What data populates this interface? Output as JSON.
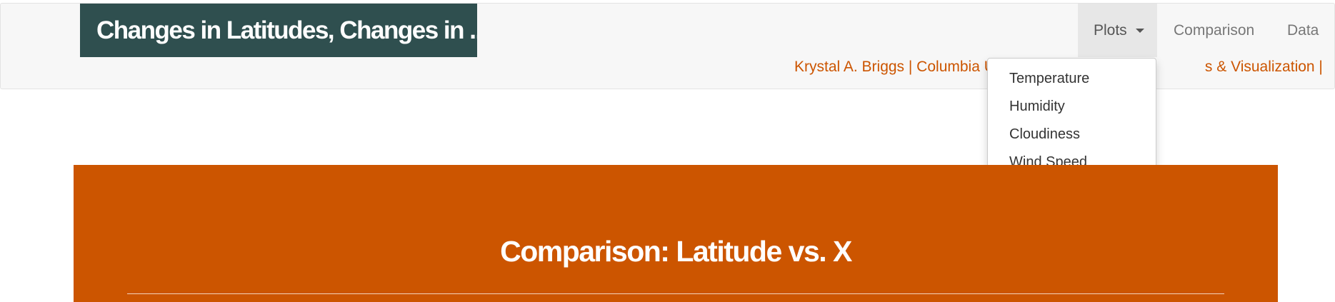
{
  "navbar": {
    "brand": "Changes in Latitudes, Changes in ...",
    "items": [
      {
        "label": "Plots",
        "has_dropdown": true,
        "active": true
      },
      {
        "label": "Comparison"
      },
      {
        "label": "Data"
      }
    ],
    "byline_left": "Krystal A. Briggs | Columbia U",
    "byline_right": "s & Visualization |"
  },
  "dropdown": {
    "items": [
      "Temperature",
      "Humidity",
      "Cloudiness",
      "Wind Speed"
    ]
  },
  "banner": {
    "title": "Comparison: Latitude vs. X"
  },
  "colors": {
    "brand_bg": "#2f4f4f",
    "accent": "#cc5500",
    "navbar_bg": "#f7f7f7"
  },
  "icons": {
    "plots_caret": "caret-down-icon"
  }
}
